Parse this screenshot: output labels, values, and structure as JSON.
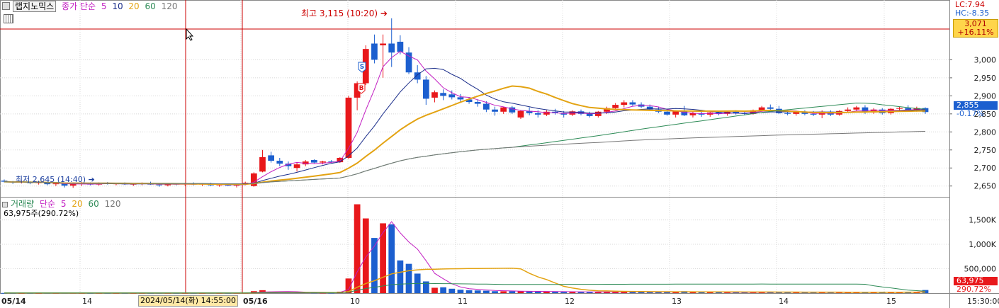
{
  "colors": {
    "up": "#e8181b",
    "down": "#1c5fcf",
    "ma5": "#c21fc2",
    "ma10": "#1a2d8a",
    "ma20": "#e3a312",
    "ma60": "#2e8b57",
    "ma120": "#777777",
    "crosshair": "#cc0000",
    "grid": "#d8d8d8"
  },
  "header": {
    "symbol": "랩지노믹스",
    "ma_label": "종가 단순",
    "ma5": "5",
    "ma10": "10",
    "ma20": "20",
    "ma60": "60",
    "ma120": "120",
    "lc": "LC:7.94",
    "hc": "HC:-8.35",
    "last_price": "3,071",
    "last_change": "+16.11%"
  },
  "price_panel": {
    "high_annotation": "최고 3,115 (10:20)",
    "low_annotation": "최저 2,645 (14:40)",
    "current_value": "2,855",
    "current_change": "-0.17%",
    "marker_s": "S",
    "marker_b": "B"
  },
  "volume_panel": {
    "label": "거래량",
    "ma_label": "단순",
    "ma5": "5",
    "ma20": "20",
    "ma60": "60",
    "ma120": "120",
    "value_line": "63,975주(290.72%)",
    "current_value": "63,975",
    "current_change": "290.72%"
  },
  "x_axis": {
    "labels": [
      "05/14",
      "14",
      "05/16",
      "10",
      "11",
      "12",
      "13",
      "14",
      "15",
      "15:30:00"
    ],
    "crosshair_time": "2024/05/14(화) 14:55:00"
  },
  "chart_data": {
    "type": "candlestick",
    "price_axis": {
      "ticks": [
        "3,000",
        "2,950",
        "2,900",
        "2,850",
        "2,800",
        "2,750",
        "2,700",
        "2,650"
      ],
      "ylim": [
        2620,
        3150
      ]
    },
    "volume_axis": {
      "ticks": [
        "1,500K",
        "1,000K",
        "500,000"
      ],
      "ylim": [
        0,
        1900000
      ]
    },
    "candles": [
      [
        2665,
        2668,
        2660,
        2662,
        4000
      ],
      [
        2662,
        2664,
        2656,
        2660,
        3500
      ],
      [
        2660,
        2665,
        2657,
        2662,
        3000
      ],
      [
        2662,
        2663,
        2655,
        2658,
        4000
      ],
      [
        2658,
        2663,
        2654,
        2661,
        3000
      ],
      [
        2661,
        2662,
        2652,
        2655,
        5000
      ],
      [
        2655,
        2660,
        2650,
        2657,
        4000
      ],
      [
        2657,
        2659,
        2646,
        2651,
        6000
      ],
      [
        2651,
        2660,
        2645,
        2656,
        5000
      ],
      [
        2656,
        2661,
        2650,
        2659,
        4000
      ],
      [
        2659,
        2660,
        2652,
        2654,
        3000
      ],
      [
        2654,
        2660,
        2651,
        2658,
        4000
      ],
      [
        2658,
        2661,
        2654,
        2656,
        3000
      ],
      [
        2656,
        2659,
        2652,
        2657,
        3000
      ],
      [
        2657,
        2660,
        2653,
        2655,
        3500
      ],
      [
        2655,
        2658,
        2650,
        2656,
        3000
      ],
      [
        2656,
        2660,
        2652,
        2658,
        4000
      ],
      [
        2658,
        2662,
        2653,
        2654,
        3500
      ],
      [
        2654,
        2657,
        2648,
        2652,
        5000
      ],
      [
        2652,
        2658,
        2649,
        2656,
        4000
      ],
      [
        2656,
        2658,
        2652,
        2655,
        3000
      ],
      [
        2655,
        2659,
        2651,
        2657,
        3000
      ],
      [
        2657,
        2660,
        2652,
        2654,
        3500
      ],
      [
        2654,
        2658,
        2650,
        2656,
        3000
      ],
      [
        2656,
        2659,
        2650,
        2652,
        6000
      ],
      [
        2652,
        2657,
        2648,
        2654,
        4000
      ],
      [
        2654,
        2657,
        2650,
        2651,
        3500
      ],
      [
        2651,
        2656,
        2646,
        2654,
        4000
      ],
      [
        2654,
        2662,
        2652,
        2659,
        5000
      ],
      [
        2650,
        2688,
        2648,
        2685,
        40000
      ],
      [
        2690,
        2750,
        2688,
        2730,
        60000
      ],
      [
        2735,
        2745,
        2715,
        2720,
        30000
      ],
      [
        2720,
        2728,
        2705,
        2712,
        20000
      ],
      [
        2712,
        2718,
        2695,
        2705,
        15000
      ],
      [
        2700,
        2715,
        2690,
        2710,
        18000
      ],
      [
        2710,
        2722,
        2705,
        2718,
        22000
      ],
      [
        2722,
        2724,
        2713,
        2715,
        12000
      ],
      [
        2715,
        2720,
        2710,
        2718,
        10000
      ],
      [
        2718,
        2722,
        2714,
        2716,
        9000
      ],
      [
        2716,
        2730,
        2714,
        2728,
        30000
      ],
      [
        2728,
        2900,
        2725,
        2895,
        300000
      ],
      [
        2895,
        2940,
        2860,
        2935,
        1820000
      ],
      [
        2935,
        3040,
        2930,
        3030,
        1530000
      ],
      [
        3045,
        3070,
        2990,
        3000,
        1130000
      ],
      [
        3040,
        3070,
        2950,
        3045,
        1430000
      ],
      [
        3045,
        3115,
        2980,
        3020,
        1410000
      ],
      [
        3050,
        3068,
        3015,
        3022,
        670000
      ],
      [
        3020,
        3035,
        2960,
        2965,
        600000
      ],
      [
        2965,
        2985,
        2935,
        2945,
        400000
      ],
      [
        2945,
        2955,
        2875,
        2892,
        240000
      ],
      [
        2895,
        2915,
        2882,
        2910,
        110000
      ],
      [
        2908,
        2918,
        2888,
        2900,
        120000
      ],
      [
        2904,
        2915,
        2890,
        2896,
        90000
      ],
      [
        2896,
        2905,
        2884,
        2890,
        70000
      ],
      [
        2890,
        2896,
        2878,
        2883,
        60000
      ],
      [
        2883,
        2890,
        2870,
        2878,
        55000
      ],
      [
        2878,
        2885,
        2855,
        2862,
        50000
      ],
      [
        2862,
        2870,
        2845,
        2856,
        40000
      ],
      [
        2856,
        2870,
        2850,
        2868,
        38000
      ],
      [
        2868,
        2872,
        2850,
        2854,
        40000
      ],
      [
        2840,
        2860,
        2836,
        2858,
        38000
      ],
      [
        2858,
        2868,
        2846,
        2852,
        34000
      ],
      [
        2852,
        2860,
        2840,
        2848,
        30000
      ],
      [
        2848,
        2860,
        2844,
        2856,
        32000
      ],
      [
        2856,
        2864,
        2848,
        2852,
        30000
      ],
      [
        2852,
        2858,
        2840,
        2848,
        26000
      ],
      [
        2848,
        2860,
        2844,
        2857,
        28000
      ],
      [
        2857,
        2862,
        2846,
        2850,
        25000
      ],
      [
        2850,
        2856,
        2840,
        2844,
        24000
      ],
      [
        2844,
        2858,
        2840,
        2856,
        26000
      ],
      [
        2856,
        2870,
        2850,
        2866,
        30000
      ],
      [
        2866,
        2880,
        2860,
        2875,
        28000
      ],
      [
        2875,
        2888,
        2868,
        2882,
        30000
      ],
      [
        2882,
        2888,
        2872,
        2876,
        25000
      ],
      [
        2876,
        2882,
        2866,
        2870,
        22000
      ],
      [
        2870,
        2876,
        2860,
        2862,
        20000
      ],
      [
        2862,
        2870,
        2852,
        2856,
        22000
      ],
      [
        2856,
        2862,
        2845,
        2848,
        24000
      ],
      [
        2848,
        2860,
        2840,
        2858,
        30000
      ],
      [
        2858,
        2872,
        2844,
        2846,
        40000
      ],
      [
        2846,
        2856,
        2840,
        2852,
        22000
      ],
      [
        2852,
        2858,
        2842,
        2848,
        20000
      ],
      [
        2848,
        2856,
        2842,
        2854,
        18000
      ],
      [
        2854,
        2858,
        2846,
        2850,
        16000
      ],
      [
        2850,
        2858,
        2845,
        2856,
        17000
      ],
      [
        2856,
        2860,
        2848,
        2852,
        15000
      ],
      [
        2852,
        2858,
        2846,
        2850,
        16000
      ],
      [
        2850,
        2862,
        2848,
        2860,
        18000
      ],
      [
        2860,
        2872,
        2856,
        2868,
        22000
      ],
      [
        2868,
        2876,
        2860,
        2864,
        20000
      ],
      [
        2864,
        2872,
        2850,
        2852,
        24000
      ],
      [
        2852,
        2860,
        2846,
        2850,
        18000
      ],
      [
        2850,
        2858,
        2845,
        2856,
        16000
      ],
      [
        2856,
        2860,
        2846,
        2850,
        15000
      ],
      [
        2850,
        2858,
        2844,
        2848,
        16000
      ],
      [
        2848,
        2860,
        2838,
        2856,
        18000
      ],
      [
        2856,
        2860,
        2844,
        2848,
        17000
      ],
      [
        2848,
        2860,
        2845,
        2858,
        20000
      ],
      [
        2858,
        2868,
        2854,
        2862,
        22000
      ],
      [
        2862,
        2872,
        2858,
        2868,
        24000
      ],
      [
        2868,
        2874,
        2850,
        2854,
        22000
      ],
      [
        2854,
        2866,
        2850,
        2862,
        20000
      ],
      [
        2862,
        2866,
        2848,
        2852,
        18000
      ],
      [
        2852,
        2866,
        2848,
        2864,
        22000
      ],
      [
        2864,
        2870,
        2856,
        2866,
        25000
      ],
      [
        2866,
        2874,
        2856,
        2860,
        24000
      ],
      [
        2860,
        2870,
        2856,
        2866,
        26000
      ],
      [
        2866,
        2868,
        2850,
        2855,
        63975
      ]
    ],
    "ma_values": {
      "ma5_start": 2658,
      "ma20_peak": 2912,
      "ma60_end": 2868,
      "ma120_end": 2784
    }
  }
}
